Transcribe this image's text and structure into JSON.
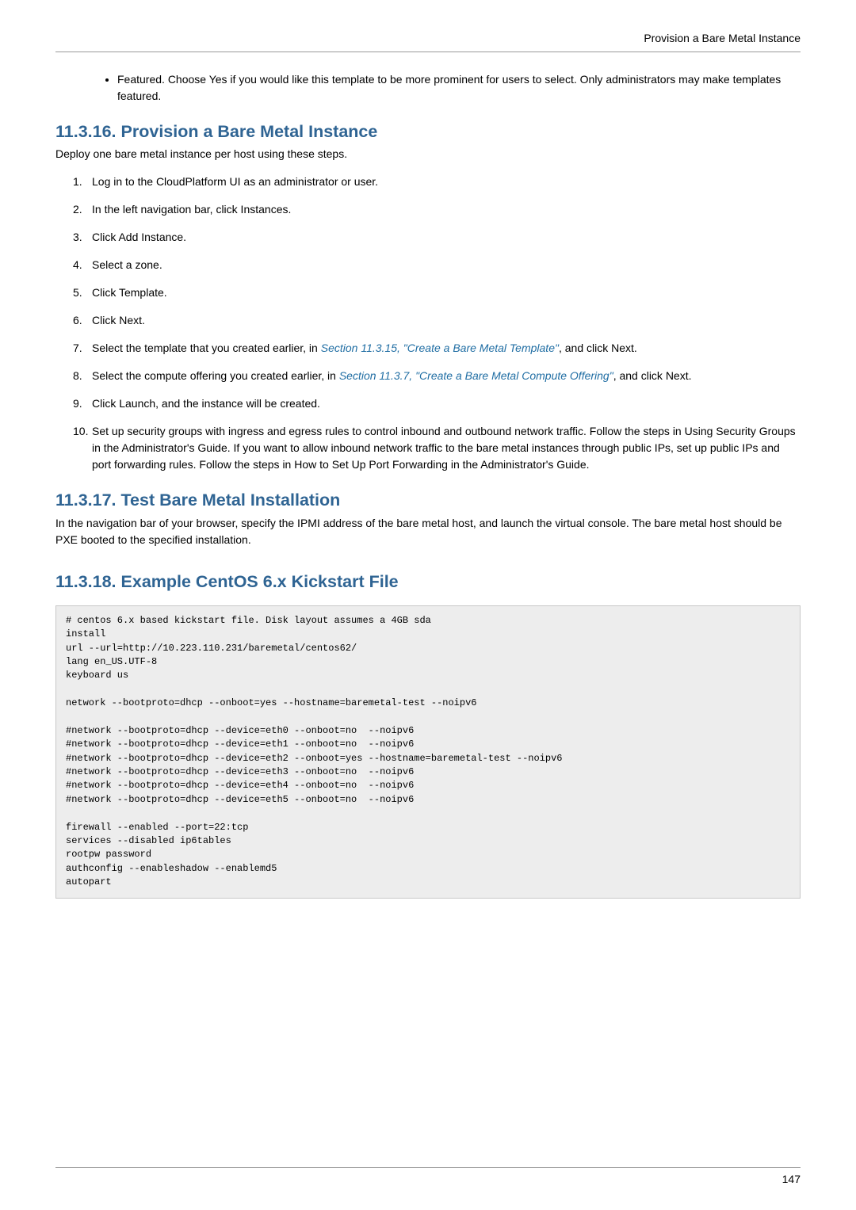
{
  "header": {
    "running_title": "Provision a Bare Metal Instance"
  },
  "bullet": {
    "text": "Featured. Choose Yes if you would like this template to be more prominent for users to select. Only administrators may make templates featured."
  },
  "section1": {
    "number": "11.3.16.",
    "title": "Provision a Bare Metal Instance",
    "intro": "Deploy one bare metal instance per host using these steps.",
    "steps": {
      "s1": "Log in to the CloudPlatform UI as an administrator or user.",
      "s2": "In the left navigation bar, click Instances.",
      "s3": "Click Add Instance.",
      "s4": "Select a zone.",
      "s5": "Click Template.",
      "s6": "Click Next.",
      "s7a": "Select the template that you created earlier, in ",
      "s7link": "Section 11.3.15, \"Create a Bare Metal Template\"",
      "s7b": ", and click Next.",
      "s8a": "Select the compute offering you created earlier, in ",
      "s8link": "Section 11.3.7, \"Create a Bare Metal Compute Offering\"",
      "s8b": ", and click Next.",
      "s9": "Click Launch, and the instance will be created.",
      "s10": "Set up security groups with ingress and egress rules to control inbound and outbound network traffic. Follow the steps in Using Security Groups in the Administrator's Guide. If you want to allow inbound network traffic to the bare metal instances through public IPs, set up public IPs and port forwarding rules. Follow the steps in How to Set Up Port Forwarding in the Administrator's Guide."
    }
  },
  "section2": {
    "number": "11.3.17.",
    "title": "Test Bare Metal Installation",
    "body": "In the navigation bar of your browser, specify the IPMI address of the bare metal host, and launch the virtual console. The bare metal host should be PXE booted to the specified installation."
  },
  "section3": {
    "number": "11.3.18.",
    "title": "Example CentOS 6.x Kickstart File",
    "code": "# centos 6.x based kickstart file. Disk layout assumes a 4GB sda\ninstall\nurl --url=http://10.223.110.231/baremetal/centos62/\nlang en_US.UTF-8\nkeyboard us\n\nnetwork --bootproto=dhcp --onboot=yes --hostname=baremetal-test --noipv6\n\n#network --bootproto=dhcp --device=eth0 --onboot=no  --noipv6\n#network --bootproto=dhcp --device=eth1 --onboot=no  --noipv6\n#network --bootproto=dhcp --device=eth2 --onboot=yes --hostname=baremetal-test --noipv6\n#network --bootproto=dhcp --device=eth3 --onboot=no  --noipv6\n#network --bootproto=dhcp --device=eth4 --onboot=no  --noipv6\n#network --bootproto=dhcp --device=eth5 --onboot=no  --noipv6\n\nfirewall --enabled --port=22:tcp\nservices --disabled ip6tables\nrootpw password\nauthconfig --enableshadow --enablemd5\nautopart"
  },
  "footer": {
    "page_number": "147"
  }
}
